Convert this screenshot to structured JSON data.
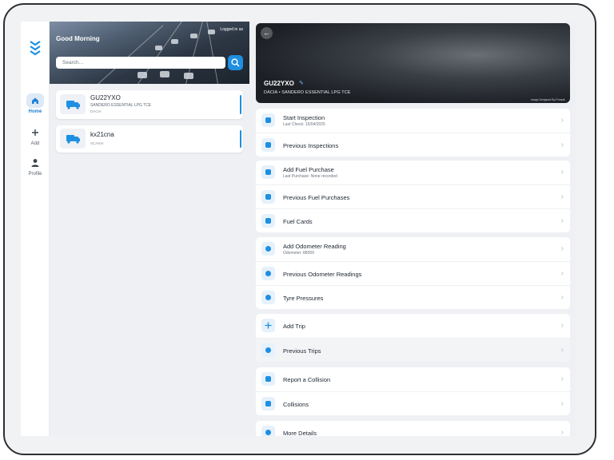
{
  "nav": {
    "items": [
      {
        "label": "Home",
        "icon": "home-icon",
        "active": true
      },
      {
        "label": "Add",
        "icon": "plus-icon",
        "active": false
      },
      {
        "label": "Profile",
        "icon": "person-icon",
        "active": false
      }
    ]
  },
  "header": {
    "greeting": "Good Morning",
    "logged_in": "Logged in as",
    "search_placeholder": "Search..."
  },
  "vehicles": [
    {
      "reg": "GU22YXO",
      "model": "SANDERO ESSENTIAL LPG TCE",
      "make": "DACIA"
    },
    {
      "reg": "kx21cna",
      "model": "",
      "make": "SCANIA"
    }
  ],
  "detail": {
    "reg": "GU22YXO",
    "subtitle": "DACIA • SANDERO ESSENTIAL LPG TCE",
    "credit": "Image Designed By Freepik"
  },
  "groups": [
    {
      "rows": [
        {
          "label": "Start Inspection",
          "sub": "Last Check: 15/04/2025",
          "icon": "clipboard-icon"
        },
        {
          "label": "Previous Inspections",
          "sub": "",
          "icon": "clipboard-check-icon"
        }
      ]
    },
    {
      "rows": [
        {
          "label": "Add Fuel Purchase",
          "sub": "Last Purchase: None recorded",
          "icon": "fuel-pump-icon"
        },
        {
          "label": "Previous Fuel Purchases",
          "sub": "",
          "icon": "fuel-pump-icon"
        },
        {
          "label": "Fuel Cards",
          "sub": "",
          "icon": "credit-card-icon"
        }
      ]
    },
    {
      "rows": [
        {
          "label": "Add Odometer Reading",
          "sub": "Odometer: 88059",
          "icon": "gauge-icon"
        },
        {
          "label": "Previous Odometer Readings",
          "sub": "",
          "icon": "gauge-icon"
        },
        {
          "label": "Tyre Pressures",
          "sub": "",
          "icon": "gauge-icon"
        }
      ]
    },
    {
      "rows": [
        {
          "label": "Add Trip",
          "sub": "",
          "icon": "plus-icon"
        },
        {
          "label": "Previous Trips",
          "sub": "",
          "icon": "route-icon",
          "highlighted": true
        }
      ]
    },
    {
      "rows": [
        {
          "label": "Report a Collision",
          "sub": "",
          "icon": "collision-icon"
        },
        {
          "label": "Collisions",
          "sub": "",
          "icon": "collision-icon"
        }
      ]
    },
    {
      "rows": [
        {
          "label": "More Details",
          "sub": "",
          "icon": "info-icon"
        }
      ]
    }
  ],
  "colors": {
    "accent": "#1e8fe1",
    "icon_bg": "#e6f1fb"
  }
}
